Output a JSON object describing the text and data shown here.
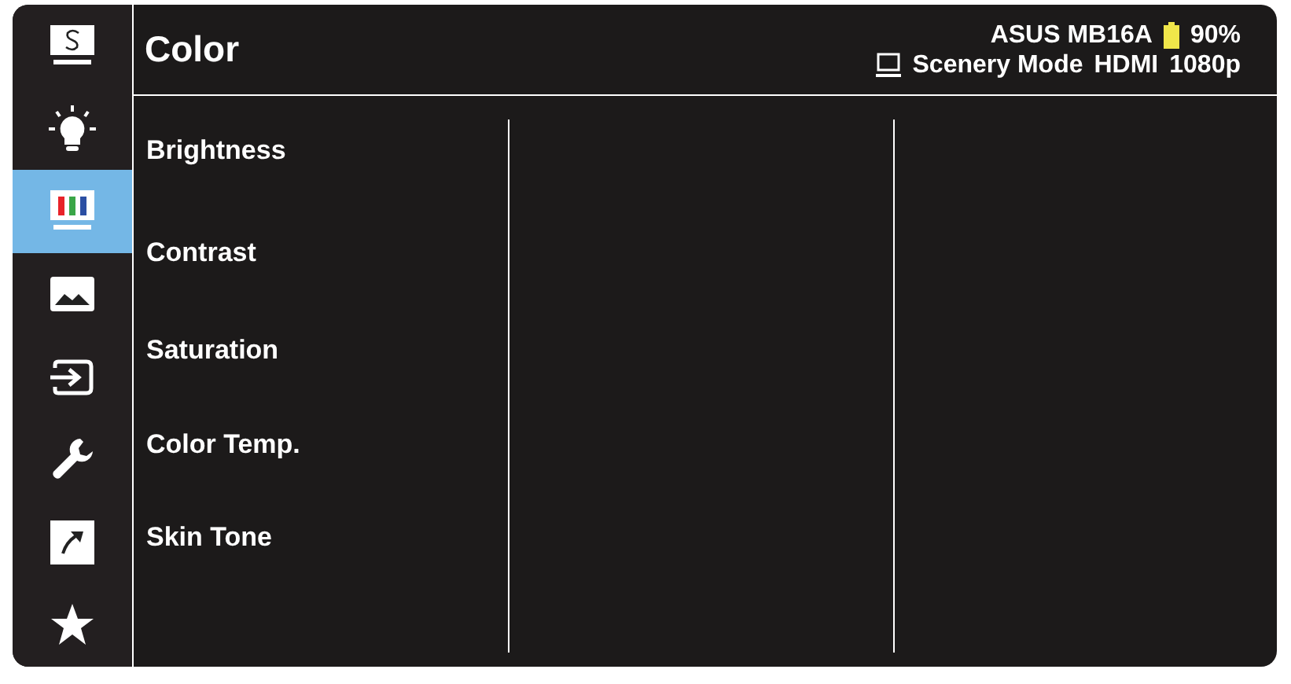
{
  "sidebar": {
    "items": [
      {
        "kind": "splendid",
        "selected": false
      },
      {
        "kind": "blue-light",
        "selected": false
      },
      {
        "kind": "color",
        "selected": true
      },
      {
        "kind": "image",
        "selected": false
      },
      {
        "kind": "input",
        "selected": false
      },
      {
        "kind": "system",
        "selected": false
      },
      {
        "kind": "shortcut",
        "selected": false
      },
      {
        "kind": "favorite",
        "selected": false
      }
    ]
  },
  "header": {
    "title": "Color",
    "model": "ASUS MB16A",
    "battery": "90%",
    "mode": "Scenery Mode",
    "input": "HDMI",
    "resolution": "1080p"
  },
  "menu": {
    "items": [
      {
        "label": "Brightness"
      },
      {
        "label": "Contrast"
      },
      {
        "label": "Saturation"
      },
      {
        "label": "Color Temp."
      },
      {
        "label": "Skin Tone"
      }
    ]
  }
}
